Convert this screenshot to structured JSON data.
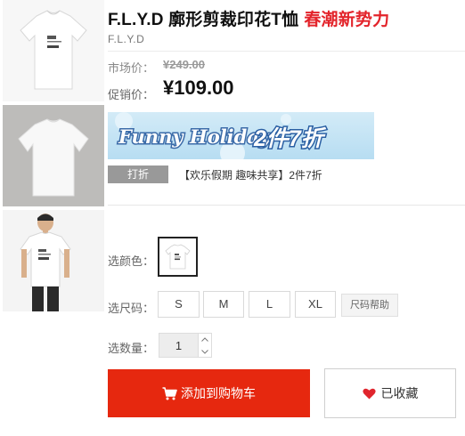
{
  "product": {
    "title": "F.L.Y.D 廓形剪裁印花T恤",
    "title_promo": "春潮新势力",
    "brand": "F.L.Y.D"
  },
  "price": {
    "market_label": "市场价：",
    "market_value": "¥249.00",
    "sale_label": "促销价：",
    "sale_value": "¥109.00"
  },
  "banner": {
    "script_text": "Funny Holiday",
    "offer_text": "2件7折"
  },
  "promotion": {
    "tag": "打折",
    "text": "【欢乐假期 趣味共享】2件7折"
  },
  "options": {
    "color_label": "选颜色：",
    "size_label": "选尺码：",
    "sizes": [
      "S",
      "M",
      "L",
      "XL"
    ],
    "size_help": "尺码帮助",
    "qty_label": "选数量：",
    "qty_value": "1"
  },
  "actions": {
    "add_to_cart": "添加到购物车",
    "favorited": "已收藏"
  },
  "colors": {
    "accent_red": "#e6280f",
    "title_promo_red": "#e3242b",
    "heart_red": "#e0252d",
    "banner_blue": "#c6e4f4",
    "banner_offer_bg": "#2a5fa3"
  },
  "icons": {
    "cart": "cart-icon",
    "heart": "heart-icon",
    "stepper_up": "chevron-up-icon",
    "stepper_down": "chevron-down-icon"
  }
}
